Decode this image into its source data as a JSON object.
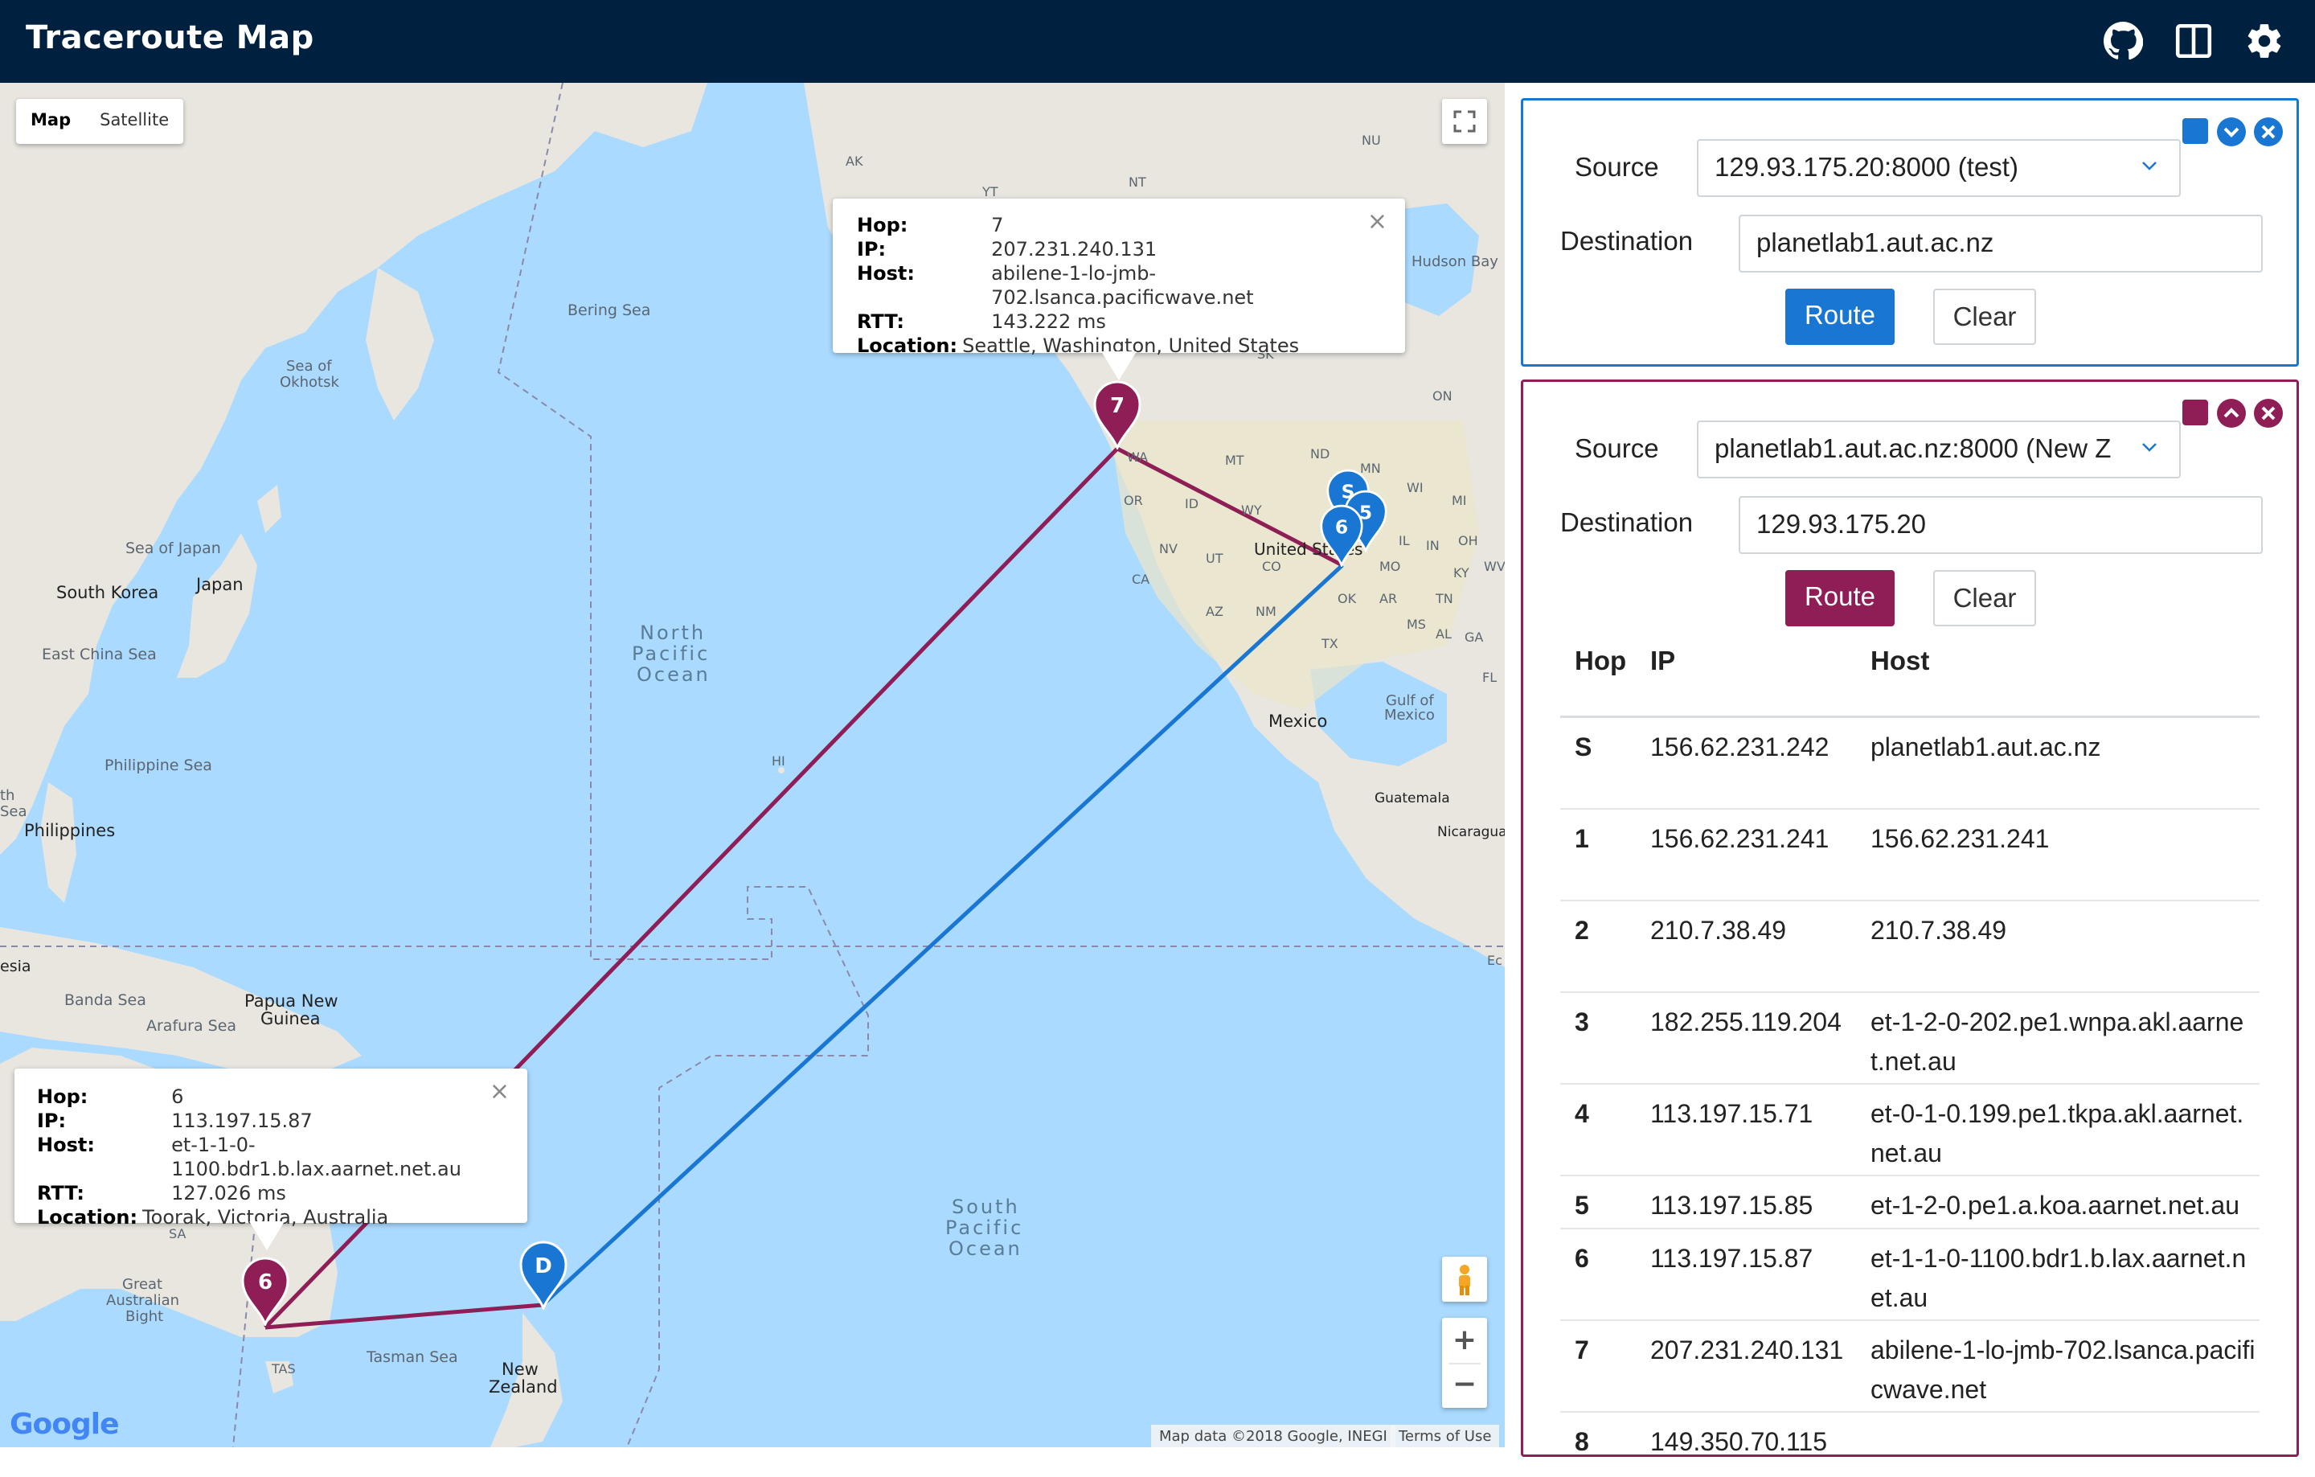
{
  "app": {
    "title": "Traceroute Map"
  },
  "header_icons": [
    {
      "name": "github-icon"
    },
    {
      "name": "layout-columns-icon"
    },
    {
      "name": "gear-icon"
    }
  ],
  "colors": {
    "navbar": "#00203f",
    "route_blue": "#1976d2",
    "route_purple": "#8e1e55",
    "water": "#aadaff",
    "land": "#e8e6df"
  },
  "map": {
    "type_map": "Map",
    "type_satellite": "Satellite",
    "attribution": "Map data ©2018 Google, INEGI",
    "terms": "Terms of Use",
    "logo": "Google",
    "zoom_in": "+",
    "zoom_out": "−",
    "labels": {
      "bering_sea": "Bering Sea",
      "sea_of_okhotsk_1": "Sea of",
      "sea_of_okhotsk_2": "Okhotsk",
      "sea_of_japan": "Sea of Japan",
      "south_korea": "South Korea",
      "japan": "Japan",
      "east_china_sea": "East China Sea",
      "philippine_sea": "Philippine Sea",
      "philippines": "Philippines",
      "north_pacific_1": "North",
      "north_pacific_2": "Pacific",
      "north_pacific_3": "Ocean",
      "south_pacific_1": "South",
      "south_pacific_2": "Pacific",
      "south_pacific_3": "Ocean",
      "hudson_bay": "Hudson Bay",
      "united_states": "United States",
      "mexico": "Mexico",
      "gulf_of_mexico_1": "Gulf of",
      "gulf_of_mexico_2": "Mexico",
      "guatemala": "Guatemala",
      "nicaragua": "Nicaragua",
      "papua_1": "Papua New",
      "papua_2": "Guinea",
      "banda_sea": "Banda Sea",
      "arafura_sea": "Arafura Sea",
      "great_australian_bight_1": "Great",
      "great_australian_bight_2": "Australian",
      "great_australian_bight_3": "Bight",
      "tasman_sea": "Tasman Sea",
      "new_zealand_1": "New",
      "new_zealand_2": "Zealand",
      "hi": "HI",
      "ak": "AK",
      "yt": "YT",
      "nt": "NT",
      "nu": "NU",
      "sk": "SK",
      "on": "ON",
      "mt": "MT",
      "nd": "ND",
      "mn": "MN",
      "wi": "WI",
      "mi": "MI",
      "or": "OR",
      "id": "ID",
      "wy": "WY",
      "nv": "NV",
      "ut": "UT",
      "co": "CO",
      "ca": "CA",
      "az": "AZ",
      "nm": "NM",
      "ok": "OK",
      "tx": "TX",
      "mo": "MO",
      "ar": "AR",
      "il": "IL",
      "in": "IN",
      "oh": "OH",
      "ky": "KY",
      "tn": "TN",
      "ms": "MS",
      "al": "AL",
      "ga": "GA",
      "fl": "FL",
      "wa": "WA",
      "sa": "SA",
      "tas": "TAS",
      "esia": "esia",
      "th_sea_1": "th",
      "th_sea_2": "Sea",
      "ec": "Ec",
      "wv": "WV"
    },
    "markers": {
      "seven": "7",
      "six_purple": "6",
      "s_blue": "S",
      "five_blue": "5",
      "six_blue": "6",
      "d_blue": "D"
    },
    "infowindow_top": {
      "hop_k": "Hop:",
      "hop_v": "7",
      "ip_k": "IP:",
      "ip_v": "207.231.240.131",
      "host_k": "Host:",
      "host_v": "abilene-1-lo-jmb-702.lsanca.pacificwave.net",
      "rtt_k": "RTT:",
      "rtt_v": "143.222 ms",
      "loc_k": "Location:",
      "loc_v": "Seattle, Washington, United States",
      "close": "×"
    },
    "infowindow_bottom": {
      "hop_k": "Hop:",
      "hop_v": "6",
      "ip_k": "IP:",
      "ip_v": "113.197.15.87",
      "host_k": "Host:",
      "host_v": "et-1-1-0-1100.bdr1.b.lax.aarnet.net.au",
      "rtt_k": "RTT:",
      "rtt_v": "127.026 ms",
      "loc_k": "Location:",
      "loc_v": "Toorak, Victoria, Australia",
      "close": "×"
    }
  },
  "panel_blue": {
    "source_label": "Source",
    "source_value": "129.93.175.20:8000 (test)",
    "destination_label": "Destination",
    "destination_value": "planetlab1.aut.ac.nz",
    "route": "Route",
    "clear": "Clear"
  },
  "panel_purple": {
    "source_label": "Source",
    "source_value": "planetlab1.aut.ac.nz:8000 (New Z",
    "destination_label": "Destination",
    "destination_value": "129.93.175.20",
    "route": "Route",
    "clear": "Clear",
    "columns": [
      "Hop",
      "IP",
      "Host"
    ],
    "rows": [
      {
        "hop": "S",
        "ip": "156.62.231.242",
        "host": "planetlab1.aut.ac.nz"
      },
      {
        "hop": "1",
        "ip": "156.62.231.241",
        "host": "156.62.231.241"
      },
      {
        "hop": "2",
        "ip": "210.7.38.49",
        "host": "210.7.38.49"
      },
      {
        "hop": "3",
        "ip": "182.255.119.204",
        "host": "et-1-2-0-202.pe1.wnpa.akl.aarnet.net.au"
      },
      {
        "hop": "4",
        "ip": "113.197.15.71",
        "host": "et-0-1-0.199.pe1.tkpa.akl.aarnet.net.au"
      },
      {
        "hop": "5",
        "ip": "113.197.15.85",
        "host": "et-1-2-0.pe1.a.koa.aarnet.net.au"
      },
      {
        "hop": "6",
        "ip": "113.197.15.87",
        "host": "et-1-1-0-1100.bdr1.b.lax.aarnet.net.au"
      },
      {
        "hop": "7",
        "ip": "207.231.240.131",
        "host": "abilene-1-lo-jmb-702.lsanca.pacificwave.net"
      },
      {
        "hop": "8",
        "ip": "149.350.70.115",
        "host": ""
      }
    ]
  }
}
